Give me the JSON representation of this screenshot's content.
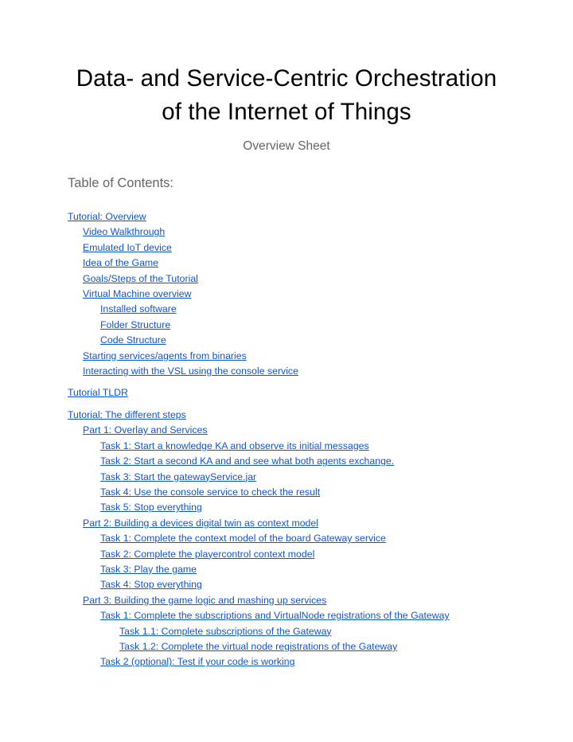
{
  "document": {
    "title": "Data- and Service-Centric Orchestration of the Internet of Things",
    "subtitle": "Overview Sheet",
    "toc_heading": "Table of Contents:"
  },
  "colors": {
    "link": "#1155cc",
    "heading_gray": "#666666",
    "title_black": "#000000",
    "page_background": "#ffffff"
  },
  "toc": {
    "entries": [
      {
        "label": "Tutorial: Overview",
        "level": 0,
        "gap_before": false
      },
      {
        "label": "Video Walkthrough",
        "level": 1,
        "gap_before": false
      },
      {
        "label": "Emulated IoT device",
        "level": 1,
        "gap_before": false
      },
      {
        "label": "Idea of the Game",
        "level": 1,
        "gap_before": false
      },
      {
        "label": "Goals/Steps of the Tutorial",
        "level": 1,
        "gap_before": false
      },
      {
        "label": "Virtual Machine overview",
        "level": 1,
        "gap_before": false
      },
      {
        "label": "Installed software",
        "level": 2,
        "gap_before": false
      },
      {
        "label": "Folder Structure",
        "level": 2,
        "gap_before": false
      },
      {
        "label": "Code Structure",
        "level": 2,
        "gap_before": false
      },
      {
        "label": "Starting services/agents from binaries",
        "level": 1,
        "gap_before": false
      },
      {
        "label": "Interacting with the VSL using the console service",
        "level": 1,
        "gap_before": false
      },
      {
        "label": "Tutorial TLDR",
        "level": 0,
        "gap_before": true
      },
      {
        "label": "Tutorial: The different steps",
        "level": 0,
        "gap_before": true
      },
      {
        "label": "Part 1: Overlay and Services",
        "level": 1,
        "gap_before": false
      },
      {
        "label": "Task 1: Start a knowledge KA and observe its initial messages",
        "level": 2,
        "gap_before": false
      },
      {
        "label": "Task 2: Start a second KA and and see what both agents exchange.",
        "level": 2,
        "gap_before": false
      },
      {
        "label": "Task 3: Start the gatewayService.jar",
        "level": 2,
        "gap_before": false
      },
      {
        "label": "Task 4: Use the console service to check the result",
        "level": 2,
        "gap_before": false
      },
      {
        "label": "Task 5: Stop everything",
        "level": 2,
        "gap_before": false
      },
      {
        "label": "Part 2: Building a devices digital twin as context model",
        "level": 1,
        "gap_before": false
      },
      {
        "label": "Task 1: Complete the context model of the board Gateway service",
        "level": 2,
        "gap_before": false
      },
      {
        "label": "Task 2: Complete the playercontrol context model",
        "level": 2,
        "gap_before": false
      },
      {
        "label": "Task 3: Play the game",
        "level": 2,
        "gap_before": false
      },
      {
        "label": "Task 4: Stop everything",
        "level": 2,
        "gap_before": false
      },
      {
        "label": "Part 3: Building the game logic and mashing up services",
        "level": 1,
        "gap_before": false
      },
      {
        "label": "Task 1: Complete the subscriptions and VirtualNode registrations of the Gateway",
        "level": 2,
        "gap_before": false
      },
      {
        "label": "Task 1.1: Complete subscriptions of the Gateway",
        "level": 3,
        "gap_before": false
      },
      {
        "label": "Task 1.2: Complete the virtual node registrations of the Gateway",
        "level": 3,
        "gap_before": false
      },
      {
        "label": "Task 2 (optional): Test if your code is working",
        "level": 2,
        "gap_before": false
      }
    ]
  }
}
